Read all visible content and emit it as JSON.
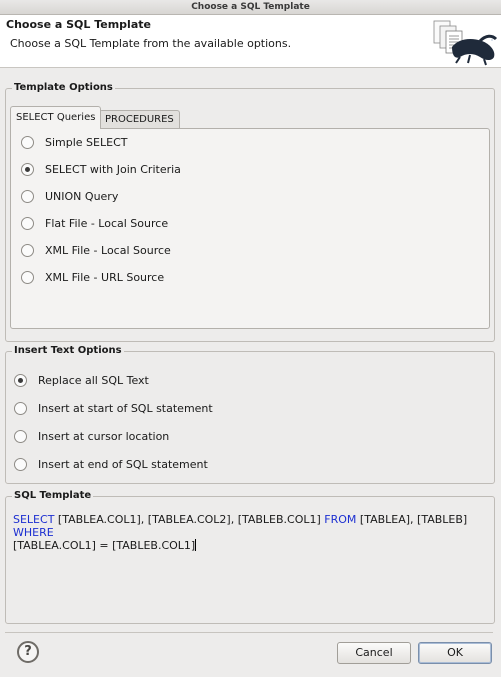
{
  "window": {
    "title": "Choose a SQL Template"
  },
  "header": {
    "title": "Choose a SQL Template",
    "description": "Choose a SQL Template from the available options."
  },
  "template_options": {
    "group_title": "Template Options",
    "tabs": [
      {
        "label": "SELECT Queries",
        "active": true
      },
      {
        "label": "PROCEDURES",
        "active": false
      }
    ],
    "options": [
      {
        "label": "Simple SELECT",
        "checked": false
      },
      {
        "label": "SELECT with Join Criteria",
        "checked": true
      },
      {
        "label": "UNION Query",
        "checked": false
      },
      {
        "label": "Flat File - Local Source",
        "checked": false
      },
      {
        "label": "XML File - Local Source",
        "checked": false
      },
      {
        "label": "XML File - URL Source",
        "checked": false
      }
    ]
  },
  "insert_text_options": {
    "group_title": "Insert Text Options",
    "options": [
      {
        "label": "Replace all SQL Text",
        "checked": true
      },
      {
        "label": "Insert at start of SQL statement",
        "checked": false
      },
      {
        "label": "Insert at cursor location",
        "checked": false
      },
      {
        "label": "Insert at end of SQL statement",
        "checked": false
      }
    ]
  },
  "sql_template": {
    "group_title": "SQL Template",
    "kw_select": "SELECT",
    "part1": " [TABLEA.COL1], [TABLEA.COL2], [TABLEB.COL1] ",
    "kw_from": "FROM",
    "part2": " [TABLEA], [TABLEB] ",
    "kw_where": "WHERE",
    "part3": "\n[TABLEA.COL1] = [TABLEB.COL1]",
    "keyword_color": "#1c2fd1"
  },
  "buttons": {
    "help_icon": "help-question-icon",
    "help_label": "?",
    "cancel_label": "Cancel",
    "ok_label": "OK"
  }
}
